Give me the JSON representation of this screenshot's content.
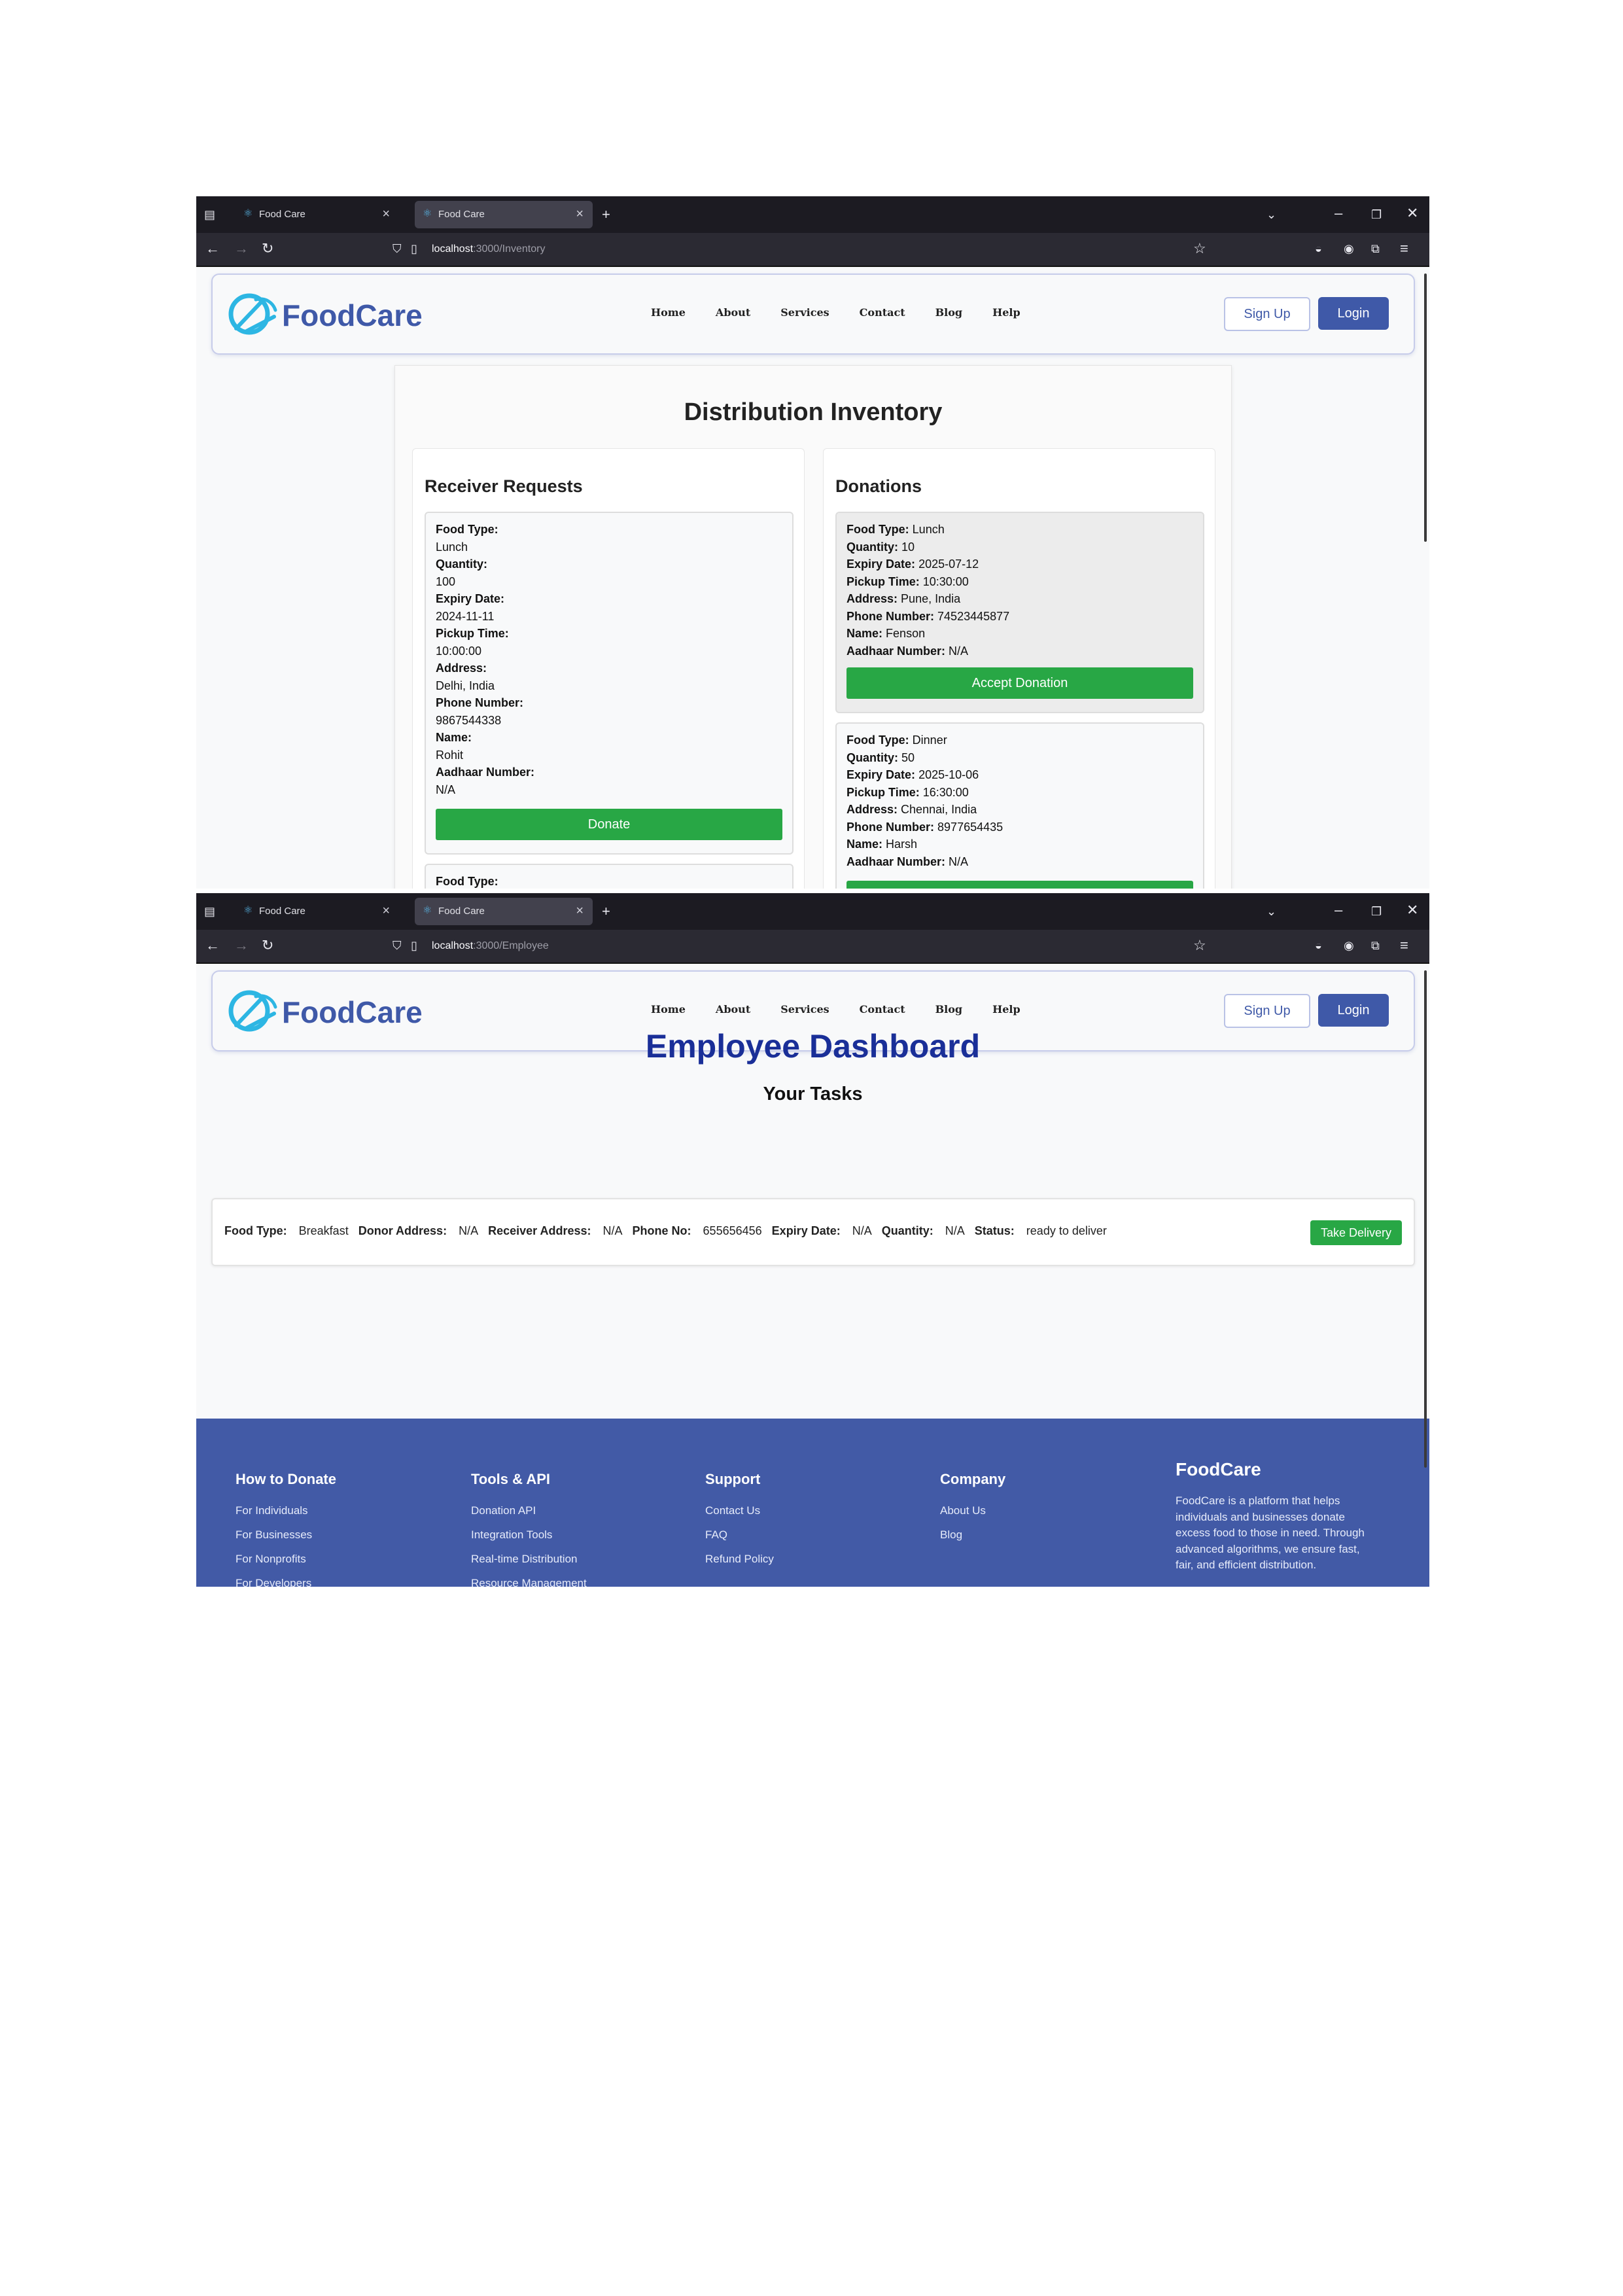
{
  "browser": {
    "tabs": [
      {
        "title": "Food Care"
      },
      {
        "title": "Food Care"
      }
    ],
    "url_top": {
      "host": "localhost",
      "rest": ":3000/Inventory"
    },
    "url_bottom": {
      "host": "localhost",
      "rest": ":3000/Employee"
    }
  },
  "header": {
    "logo_text": "FoodCare",
    "nav": [
      "Home",
      "About",
      "Services",
      "Contact",
      "Blog",
      "Help"
    ],
    "signup_label": "Sign Up",
    "login_label": "Login"
  },
  "inventory": {
    "title": "Distribution Inventory",
    "receiver_title": "Receiver Requests",
    "donations_title": "Donations",
    "receiver_requests": [
      {
        "food_type_label": "Food Type:",
        "food_type": "Lunch",
        "quantity_label": "Quantity:",
        "quantity": "100",
        "expiry_label": "Expiry Date:",
        "expiry": "2024-11-11",
        "pickup_label": "Pickup Time:",
        "pickup": "10:00:00",
        "address_label": "Address:",
        "address": "Delhi, India",
        "phone_label": "Phone Number:",
        "phone": "9867544338",
        "name_label": "Name:",
        "name": "Rohit",
        "aadhaar_label": "Aadhaar Number:",
        "aadhaar": "N/A",
        "button": "Donate"
      },
      {
        "food_type_label": "Food Type:"
      }
    ],
    "donations": [
      {
        "food_type_label": "Food Type:",
        "food_type": "Lunch",
        "quantity_label": "Quantity:",
        "quantity": "10",
        "expiry_label": "Expiry Date:",
        "expiry": "2025-07-12",
        "pickup_label": "Pickup Time:",
        "pickup": "10:30:00",
        "address_label": "Address:",
        "address": "Pune, India",
        "phone_label": "Phone Number:",
        "phone": "74523445877",
        "name_label": "Name:",
        "name": "Fenson",
        "aadhaar_label": "Aadhaar Number:",
        "aadhaar": "N/A",
        "button": "Accept Donation"
      },
      {
        "food_type_label": "Food Type:",
        "food_type": "Dinner",
        "quantity_label": "Quantity:",
        "quantity": "50",
        "expiry_label": "Expiry Date:",
        "expiry": "2025-10-06",
        "pickup_label": "Pickup Time:",
        "pickup": "16:30:00",
        "address_label": "Address:",
        "address": "Chennai, India",
        "phone_label": "Phone Number:",
        "phone": "8977654435",
        "name_label": "Name:",
        "name": "Harsh",
        "aadhaar_label": "Aadhaar Number:",
        "aadhaar": "N/A"
      }
    ]
  },
  "employee": {
    "title": "Employee Dashboard",
    "subtitle": "Your Tasks",
    "task": {
      "food_type_label": "Food Type:",
      "food_type": "Breakfast",
      "donor_label": "Donor Address:",
      "donor": "N/A",
      "receiver_label": "Receiver Address:",
      "receiver": "N/A",
      "phone_label": "Phone No:",
      "phone": "655656456",
      "expiry_label": "Expiry Date:",
      "expiry": "N/A",
      "quantity_label": "Quantity:",
      "quantity": "N/A",
      "status_label": "Status:",
      "status": "ready to deliver",
      "button": "Take Delivery"
    }
  },
  "footer": {
    "columns": [
      {
        "title": "How to Donate",
        "links": [
          "For Individuals",
          "For Businesses",
          "For Nonprofits",
          "For Developers"
        ]
      },
      {
        "title": "Tools & API",
        "links": [
          "Donation API",
          "Integration Tools",
          "Real-time Distribution",
          "Resource Management"
        ]
      },
      {
        "title": "Support",
        "links": [
          "Contact Us",
          "FAQ",
          "Refund Policy"
        ]
      },
      {
        "title": "Company",
        "links": [
          "About Us",
          "Blog"
        ]
      }
    ],
    "brand_title": "FoodCare",
    "brand_text": "FoodCare is a platform that helps individuals and businesses donate excess food to those in need. Through advanced algorithms, we ensure fast, fair, and efficient distribution."
  },
  "colors": {
    "brand": "#3f59a8",
    "accent_green": "#28a745",
    "title_blue": "#1a2f98",
    "footer_bg": "#425aa6"
  }
}
